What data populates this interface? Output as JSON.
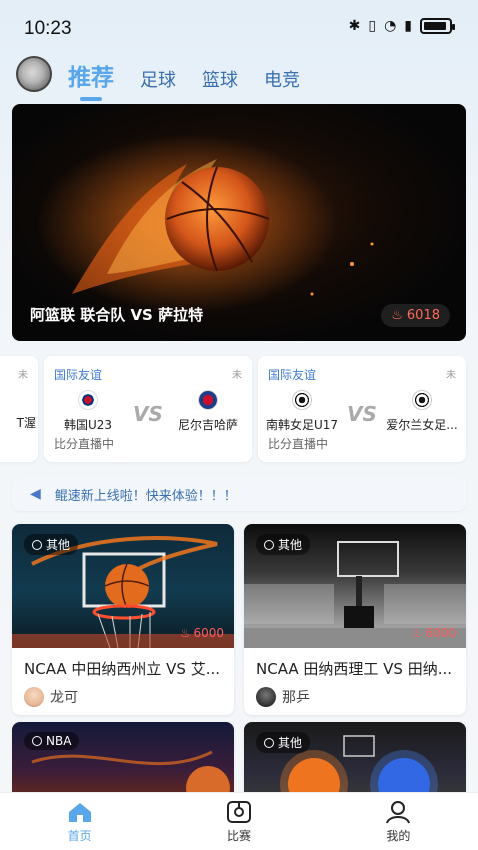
{
  "status_bar": {
    "time": "10:23"
  },
  "nav": {
    "tabs": [
      "推荐",
      "足球",
      "篮球",
      "电竞"
    ],
    "active_tab": 0
  },
  "banner": {
    "title": "阿篮联 联合队 VS 萨拉特",
    "heat": "6018"
  },
  "matches": [
    {
      "league": "国际友谊",
      "state": "未",
      "team_a": "韩国U23",
      "team_b": "尼尔吉哈萨",
      "vs": "VS",
      "status": "比分直播中"
    },
    {
      "league": "国际友谊",
      "state": "未",
      "team_a": "南韩女足U17",
      "team_b": "爱尔兰女足...",
      "vs": "VS",
      "status": "比分直播中"
    }
  ],
  "partial_card": {
    "state": "未",
    "team_partial": "T渥"
  },
  "notice": {
    "text": "鲲速新上线啦！快来体验！！！"
  },
  "games": [
    {
      "tag": "其他",
      "heat": "6000",
      "title": "NCAA 中田纳西州立 VS 艾...",
      "anchor": "龙可"
    },
    {
      "tag": "其他",
      "heat": "6000",
      "title": "NCAA 田纳西理工 VS 田纳...",
      "anchor": "那乒"
    },
    {
      "tag": "NBA"
    },
    {
      "tag": "其他"
    }
  ],
  "bottom_nav": [
    {
      "label": "首页",
      "icon": "home-icon"
    },
    {
      "label": "比赛",
      "icon": "match-icon"
    },
    {
      "label": "我的",
      "icon": "profile-icon"
    }
  ],
  "colors": {
    "accent": "#5aa6ea",
    "heat": "#ff5b5b",
    "league": "#3f7bd0"
  }
}
